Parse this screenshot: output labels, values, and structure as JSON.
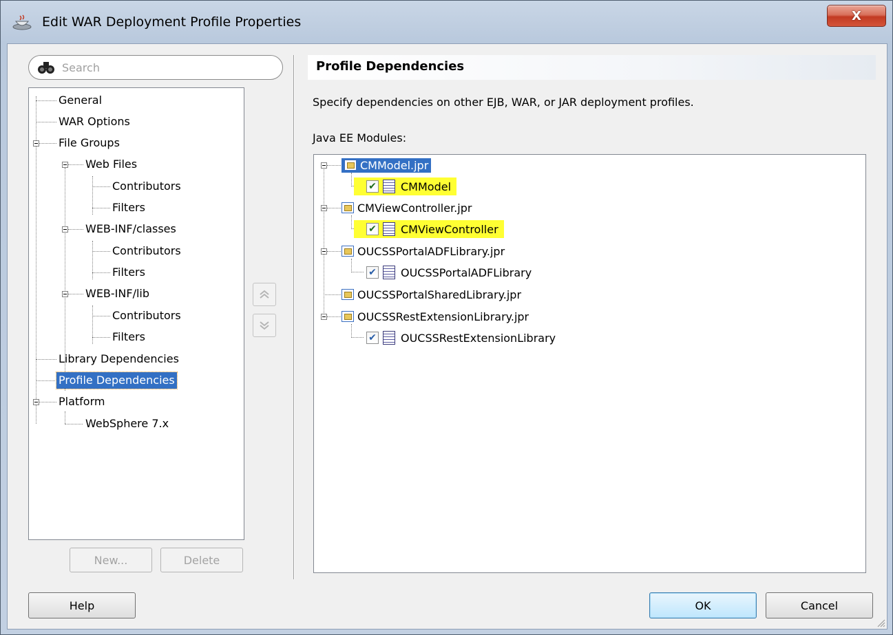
{
  "window": {
    "title": "Edit WAR Deployment Profile Properties",
    "close_label": "X"
  },
  "search": {
    "placeholder": "Search"
  },
  "nav_tree": {
    "items": [
      {
        "label": "General"
      },
      {
        "label": "WAR Options"
      },
      {
        "label": "File Groups"
      },
      {
        "label": "Web Files"
      },
      {
        "label": "Contributors"
      },
      {
        "label": "Filters"
      },
      {
        "label": "WEB-INF/classes"
      },
      {
        "label": "Contributors"
      },
      {
        "label": "Filters"
      },
      {
        "label": "WEB-INF/lib"
      },
      {
        "label": "Contributors"
      },
      {
        "label": "Filters"
      },
      {
        "label": "Library Dependencies"
      },
      {
        "label": "Profile Dependencies"
      },
      {
        "label": "Platform"
      },
      {
        "label": "WebSphere 7.x"
      }
    ],
    "selected": "Profile Dependencies"
  },
  "left_buttons": {
    "new_label": "New...",
    "delete_label": "Delete"
  },
  "panel": {
    "title": "Profile Dependencies",
    "description": "Specify dependencies on other EJB, WAR, or JAR deployment profiles.",
    "modules_label": "Java EE Modules:"
  },
  "modules": [
    {
      "project": "CMModel.jpr",
      "profile": "CMModel",
      "checked": true
    },
    {
      "project": "CMViewController.jpr",
      "profile": "CMViewController",
      "checked": true
    },
    {
      "project": "OUCSSPortalADFLibrary.jpr",
      "profile": "OUCSSPortalADFLibrary",
      "checked": true
    },
    {
      "project": "OUCSSPortalSharedLibrary.jpr"
    },
    {
      "project": "OUCSSRestExtensionLibrary.jpr",
      "profile": "OUCSSRestExtensionLibrary",
      "checked": true
    }
  ],
  "footer": {
    "help_label": "Help",
    "ok_label": "OK",
    "cancel_label": "Cancel"
  },
  "colors": {
    "selection": "#3370c4",
    "highlight": "#ffff33"
  },
  "icons": {
    "app": "java-cup-icon",
    "search": "binoculars-icon",
    "move_up": "double-chevron-up-icon",
    "move_down": "double-chevron-down-icon"
  }
}
